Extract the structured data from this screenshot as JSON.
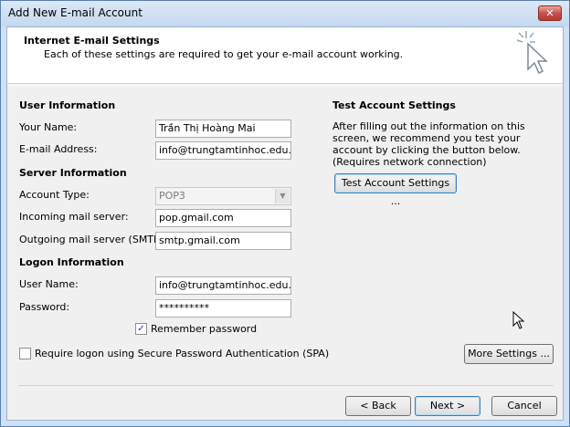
{
  "window": {
    "title": "Add New E-mail Account",
    "close_glyph": "✕"
  },
  "header": {
    "title": "Internet E-mail Settings",
    "subtitle": "Each of these settings are required to get your e-mail account working."
  },
  "user_info": {
    "section_title": "User Information",
    "name_label": "Your Name:",
    "name_value": "Trần Thị Hoàng Mai",
    "email_label": "E-mail Address:",
    "email_value": "info@trungtamtinhoc.edu.vn"
  },
  "server_info": {
    "section_title": "Server Information",
    "account_type_label": "Account Type:",
    "account_type_value": "POP3",
    "incoming_label": "Incoming mail server:",
    "incoming_value": "pop.gmail.com",
    "outgoing_label": "Outgoing mail server (SMTP):",
    "outgoing_value": "smtp.gmail.com"
  },
  "logon_info": {
    "section_title": "Logon Information",
    "username_label": "User Name:",
    "username_value": "info@trungtamtinhoc.edu.vn",
    "password_label": "Password:",
    "password_value": "**********",
    "remember_label": "Remember password",
    "remember_checked": true,
    "spa_label": "Require logon using Secure Password Authentication (SPA)",
    "spa_checked": false
  },
  "test_settings": {
    "section_title": "Test Account Settings",
    "description": "After filling out the information on this screen, we recommend you test your account by clicking the button below. (Requires network connection)",
    "test_button": "Test Account Settings ..."
  },
  "buttons": {
    "more_settings": "More Settings ...",
    "back": "< Back",
    "next": "Next >",
    "cancel": "Cancel"
  },
  "icons": {
    "header_icon": "cursor-sparkle-icon",
    "close": "close-icon",
    "mouse": "mouse-pointer-icon",
    "dropdown": "chevron-down-icon"
  }
}
